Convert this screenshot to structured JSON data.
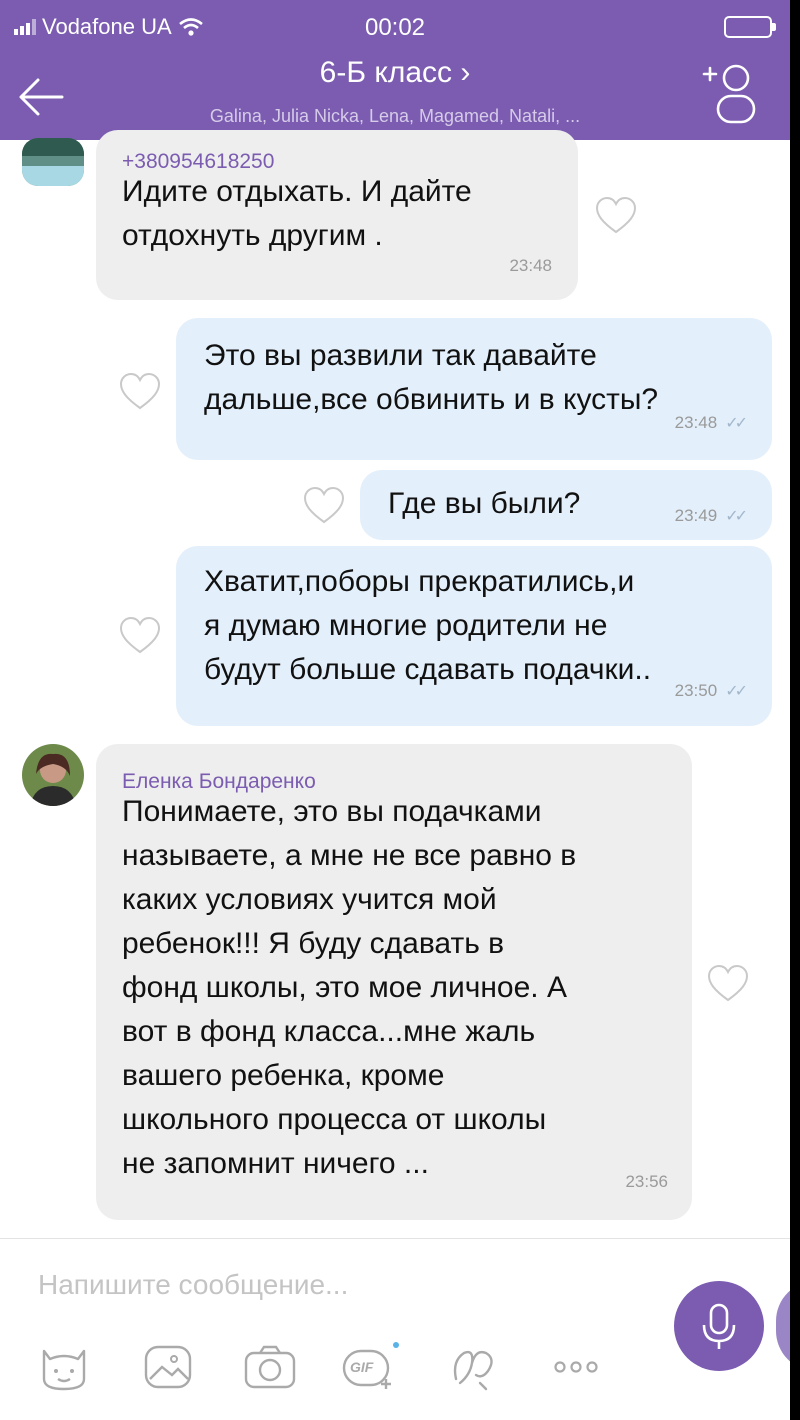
{
  "status_bar": {
    "carrier": "Vodafone UA",
    "time": "00:02"
  },
  "header": {
    "title": "6-Б класс ›",
    "members": "Galina, Julia Nicka, Lena, Magamed, Natali, ..."
  },
  "messages": [
    {
      "direction": "in",
      "sender": "+380954618250",
      "lines": [
        "Идите отдыхать. И дайте",
        "отдохнуть другим ."
      ],
      "time": "23:48"
    },
    {
      "direction": "out",
      "lines": [
        "Это вы развили так давайте",
        "дальше,все обвинить и в кусты?"
      ],
      "time": "23:48"
    },
    {
      "direction": "out",
      "lines": [
        "Где вы были?"
      ],
      "time": "23:49"
    },
    {
      "direction": "out",
      "lines": [
        "Хватит,поборы прекратились,и",
        "я думаю многие родители не",
        "будут больше сдавать подачки.."
      ],
      "time": "23:50"
    },
    {
      "direction": "in",
      "sender": "Еленка Бондаренко",
      "lines": [
        "Понимаете, это вы подачками",
        "называете, а мне не все равно в",
        "каких условиях учится мой",
        "ребенок!!! Я буду сдавать в",
        "фонд школы, это мое личное. А",
        "вот в фонд класса...мне жаль",
        "вашего ребенка, кроме",
        "школьного процесса от школы",
        "не запомнит ничего ..."
      ],
      "time": "23:56"
    }
  ],
  "input": {
    "placeholder": "Напишите сообщение..."
  },
  "toolbar": {
    "gif_label": "GIF"
  },
  "icons": [
    "back-arrow-icon",
    "add-member-icon",
    "heart-icon",
    "read-ticks-icon",
    "microphone-icon",
    "sticker-icon",
    "gallery-icon",
    "camera-icon",
    "gif-icon",
    "doodle-icon",
    "more-icon"
  ],
  "colors": {
    "accent": "#7b5cb0",
    "incoming_bubble": "#eeeeee",
    "outgoing_bubble": "#e3effa",
    "sender_name": "#7b5cb0"
  }
}
